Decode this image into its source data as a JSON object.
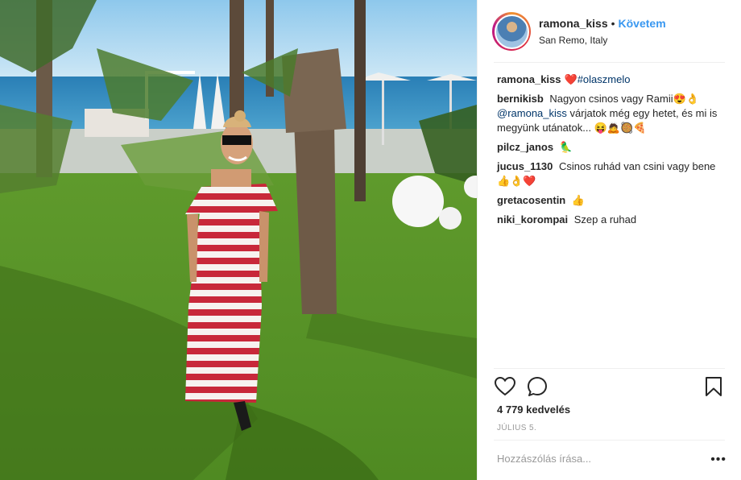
{
  "header": {
    "username": "ramona_kiss",
    "separator": "•",
    "follow_label": "Követem",
    "location": "San Remo, Italy"
  },
  "caption": {
    "username": "ramona_kiss",
    "emoji": "❤️",
    "hashtag": "#olaszmelo"
  },
  "comments": [
    {
      "username": "bernikisb",
      "text": "Nagyon csinos vagy Ramii😍👌",
      "mention": "@ramona_kiss",
      "text2": "várjatok még egy hetet, és mi is megyünk utánatok... 😝🙇🥘🍕"
    },
    {
      "username": "pilcz_janos",
      "text": "🦜"
    },
    {
      "username": "jucus_1130",
      "text": "Csinos ruhád van csini vagy bene 👍👌❤️"
    },
    {
      "username": "gretacosentin",
      "text": "👍"
    },
    {
      "username": "niki_korompai",
      "text": "Szep a ruhad"
    }
  ],
  "actions": {
    "like_icon": "heart-icon",
    "comment_icon": "comment-icon",
    "save_icon": "bookmark-icon"
  },
  "likes": "4 779 kedvelés",
  "date": "JÚLIUS 5.",
  "add_comment": {
    "placeholder": "Hozzászólás írása..."
  },
  "more_label": "•••",
  "colors": {
    "accent": "#3897f0",
    "link": "#003569",
    "muted": "#999999"
  }
}
